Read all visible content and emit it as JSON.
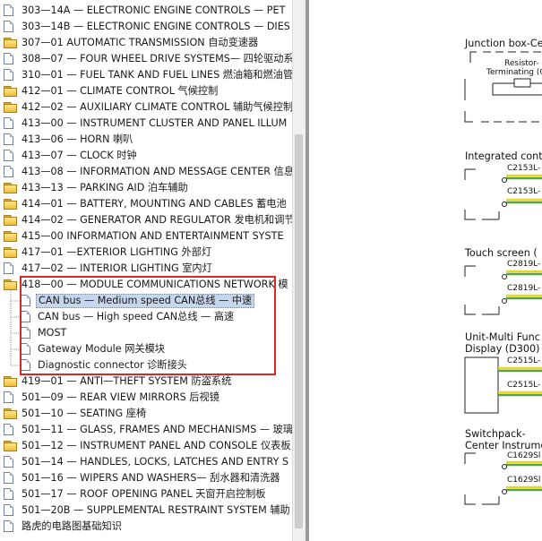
{
  "tree": {
    "items": [
      {
        "label": "303—14A — ELECTRONIC ENGINE CONTROLS — PET",
        "icon": "document-icon",
        "level": 0
      },
      {
        "label": "303—14B — ELECTRONIC ENGINE CONTROLS — DIES",
        "icon": "document-icon",
        "level": 0
      },
      {
        "label": "307—01 AUTOMATIC TRANSMISSION 自动变速器",
        "icon": "folder-icon",
        "level": 0
      },
      {
        "label": "308—07 — FOUR WHEEL DRIVE SYSTEMS— 四轮驱动系",
        "icon": "document-icon",
        "level": 0
      },
      {
        "label": "310—01 — FUEL TANK AND FUEL LINES 燃油箱和燃油管",
        "icon": "document-icon",
        "level": 0
      },
      {
        "label": "412—01 — CLIMATE CONTROL 气候控制",
        "icon": "folder-icon",
        "level": 0
      },
      {
        "label": "412—02 — AUXILIARY CLIMATE CONTROL 辅助气候控制",
        "icon": "folder-icon",
        "level": 0
      },
      {
        "label": "413—00 — INSTRUMENT CLUSTER AND PANEL ILLUM",
        "icon": "document-icon",
        "level": 0
      },
      {
        "label": "413—06 — HORN 喇叭",
        "icon": "document-icon",
        "level": 0
      },
      {
        "label": "413—07 — CLOCK 时钟",
        "icon": "document-icon",
        "level": 0
      },
      {
        "label": "413—08 — INFORMATION AND MESSAGE CENTER 信息",
        "icon": "document-icon",
        "level": 0
      },
      {
        "label": "413—13 — PARKING AID 泊车辅助",
        "icon": "folder-icon",
        "level": 0
      },
      {
        "label": "414—01 — BATTERY, MOUNTING AND CABLES 蓄电池",
        "icon": "folder-icon",
        "level": 0
      },
      {
        "label": "414—02 — GENERATOR AND REGULATOR 发电机和调节",
        "icon": "folder-icon",
        "level": 0
      },
      {
        "label": "415—00 INFORMATION AND ENTERTAINMENT SYSTE",
        "icon": "folder-icon",
        "level": 0
      },
      {
        "label": "417—01 —EXTERIOR LIGHTING 外部灯",
        "icon": "folder-icon",
        "level": 0
      },
      {
        "label": "417—02 — INTERIOR LIGHTING 室内灯",
        "icon": "document-icon",
        "level": 0
      },
      {
        "label": "418—00 — MODULE COMMUNICATIONS NETWORK 模",
        "icon": "folder-open-icon",
        "level": 0
      },
      {
        "label": "CAN bus — Medium speed CAN总线 — 中速",
        "icon": "document-icon",
        "level": 1,
        "selected": true
      },
      {
        "label": "CAN bus — High speed CAN总线 — 高速",
        "icon": "document-icon",
        "level": 1
      },
      {
        "label": "MOST",
        "icon": "document-icon",
        "level": 1
      },
      {
        "label": "Gateway Module 网关模块",
        "icon": "document-icon",
        "level": 1
      },
      {
        "label": "Diagnostic connector 诊断接头",
        "icon": "document-icon",
        "level": 1
      },
      {
        "label": "419—01 — ANTI—THEFT SYSTEM 防盗系统",
        "icon": "folder-icon",
        "level": 0
      },
      {
        "label": "501—09 — REAR VIEW MIRRORS 后视镜",
        "icon": "document-icon",
        "level": 0
      },
      {
        "label": "501—10 — SEATING 座椅",
        "icon": "folder-icon",
        "level": 0
      },
      {
        "label": "501—11 — GLASS, FRAMES AND MECHANISMS — 玻璃",
        "icon": "document-icon",
        "level": 0
      },
      {
        "label": "501—12 — INSTRUMENT PANEL AND CONSOLE 仪表板",
        "icon": "folder-icon",
        "level": 0
      },
      {
        "label": "501—14 — HANDLES, LOCKS, LATCHES AND ENTRY S",
        "icon": "document-icon",
        "level": 0
      },
      {
        "label": "501—16 — WIPERS AND WASHERS— 刮水器和清洗器",
        "icon": "document-icon",
        "level": 0
      },
      {
        "label": "501—17 — ROOF OPENING PANEL 天窗开启控制板",
        "icon": "document-icon",
        "level": 0
      },
      {
        "label": "501—20B — SUPPLEMENTAL RESTRAINT SYSTEM 辅助",
        "icon": "document-icon",
        "level": 0
      },
      {
        "label": "路虎的电路图基础知识",
        "icon": "document-icon",
        "level": 0
      }
    ]
  },
  "diagram": {
    "titles": {
      "junction_box": "Junction box-Ce",
      "junction_sub": "Resistor-",
      "junction_sub2": "Terminating (G",
      "integrated": "Integrated cont",
      "touch": "Touch screen (",
      "unit_multi_1": "Unit-Multi Func",
      "unit_multi_2": "Display (D300)",
      "switchpack_1": "Switchpack-",
      "switchpack_2": "Center Instrume"
    },
    "pins": {
      "p1": "C2153L-",
      "p2": "C2153L-",
      "p3": "C2819L-",
      "p4": "C2819L-",
      "p5": "C2515L-",
      "p6": "C2515L-",
      "p7": "C1629Sl",
      "p8": "C1629Sl"
    },
    "wire_colors": {
      "yellow": "#e8d820",
      "green": "#5aa24a"
    }
  }
}
